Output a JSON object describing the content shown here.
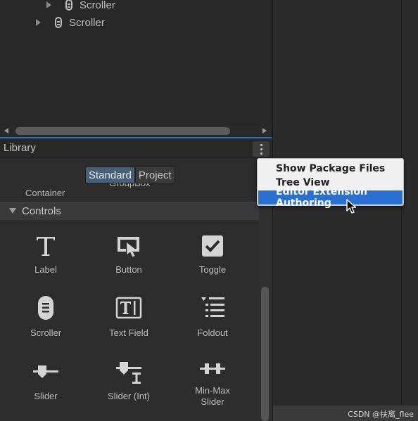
{
  "hierarchy": {
    "rows": [
      {
        "label": "Scroller"
      },
      {
        "label": "Scroller"
      }
    ]
  },
  "library": {
    "title": "Library",
    "tabs": [
      {
        "label": "Standard",
        "active": true
      },
      {
        "label": "Project",
        "active": false
      }
    ],
    "partial_items": {
      "left": "Container",
      "middle": "GroupBox"
    },
    "section": {
      "title": "Controls",
      "expanded": true
    },
    "controls": [
      {
        "label": "Label",
        "icon": "text-t-icon"
      },
      {
        "label": "Button",
        "icon": "button-cursor-icon"
      },
      {
        "label": "Toggle",
        "icon": "checkbox-checked-icon"
      },
      {
        "label": "Scroller",
        "icon": "scroller-icon"
      },
      {
        "label": "Text Field",
        "icon": "text-field-icon"
      },
      {
        "label": "Foldout",
        "icon": "foldout-list-icon"
      },
      {
        "label": "Slider",
        "icon": "slider-icon"
      },
      {
        "label": "Slider (Int)",
        "icon": "slider-int-icon"
      },
      {
        "label": "Min-Max\nSlider",
        "icon": "min-max-slider-icon"
      }
    ]
  },
  "context_menu": {
    "items": [
      {
        "label": "Show Package Files",
        "highlighted": false
      },
      {
        "label": "Tree View",
        "highlighted": false
      },
      {
        "label": "Editor Extension Authoring",
        "highlighted": true
      }
    ]
  },
  "watermark": "CSDN @扶离_flee",
  "colors": {
    "panel_bg": "#282828",
    "accent_blue": "#2f6fb5",
    "menu_highlight": "#2a6fd6",
    "tab_active": "#46607a",
    "menu_bg": "#f0f0f0"
  }
}
